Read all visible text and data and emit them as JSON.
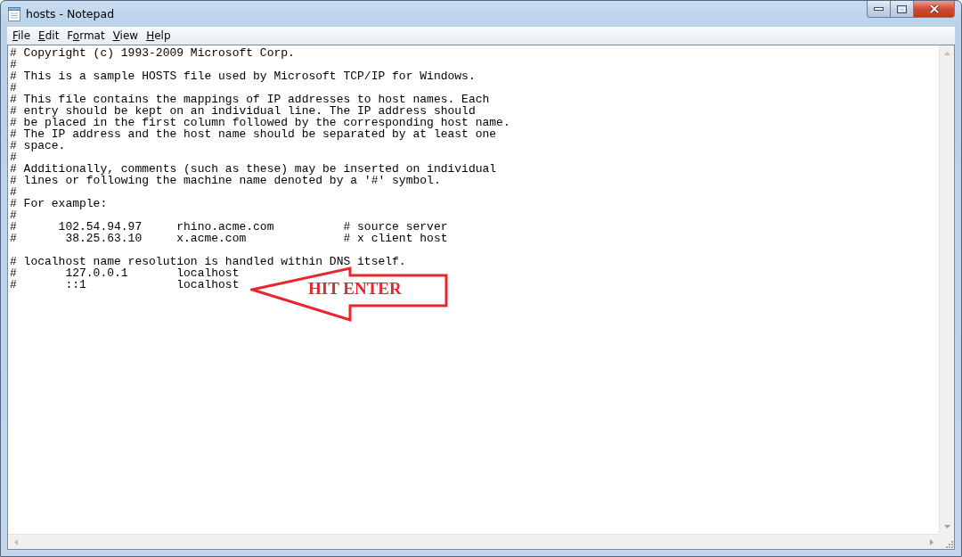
{
  "window": {
    "title": "hosts - Notepad"
  },
  "menu": [
    {
      "key": "F",
      "after": "ile"
    },
    {
      "key": "E",
      "after": "dit"
    },
    {
      "before": "F",
      "key": "o",
      "after": "rmat"
    },
    {
      "key": "V",
      "after": "iew"
    },
    {
      "key": "H",
      "after": "elp"
    }
  ],
  "document": {
    "blocks": [
      [
        "# Copyright (c) 1993-2009 Microsoft Corp.",
        "#",
        "# This is a sample HOSTS file used by Microsoft TCP/IP for Windows.",
        "#",
        "# This file contains the mappings of IP addresses to host names. Each",
        "# entry should be kept on an individual line. The IP address should",
        "# be placed in the first column followed by the corresponding host name.",
        "# The IP address and the host name should be separated by at least one",
        "# space.",
        "#",
        "# Additionally, comments (such as these) may be inserted on individual",
        "# lines or following the machine name denoted by a '#' symbol.",
        "#",
        "# For example:",
        "#",
        "#      102.54.94.97     rhino.acme.com          # source server",
        "#       38.25.63.10     x.acme.com              # x client host"
      ],
      [
        "# localhost name resolution is handled within DNS itself.",
        "#       127.0.0.1       localhost",
        "#       ::1             localhost"
      ]
    ]
  },
  "annotation": {
    "label": "HIT ENTER"
  }
}
